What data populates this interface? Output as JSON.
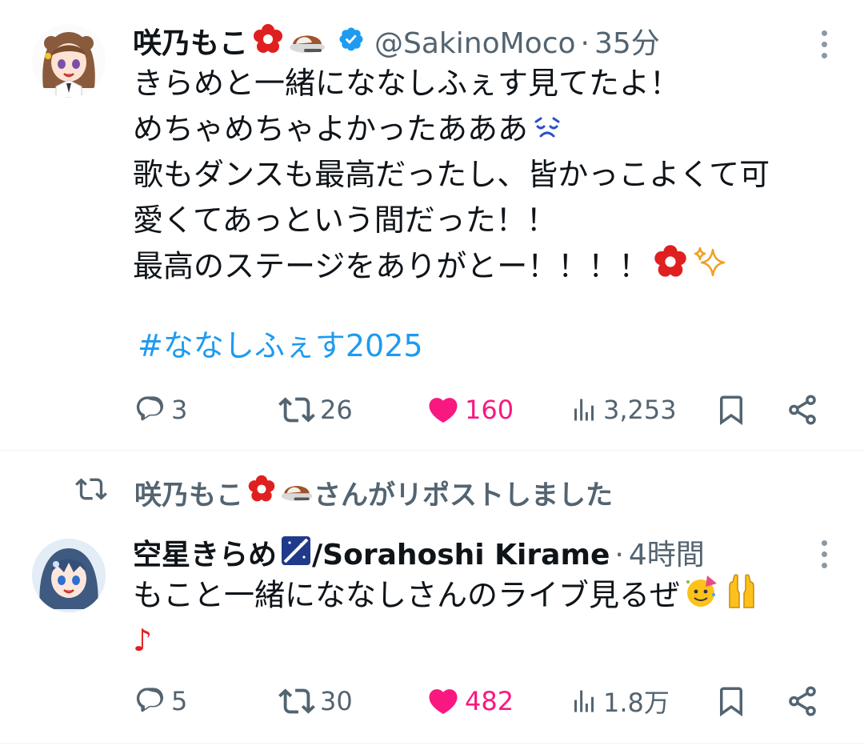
{
  "tweets": [
    {
      "author_name": "咲乃もこ",
      "handle": "@SakinoMoco",
      "separator": "·",
      "time": "35分",
      "lines": [
        "きらめと一緒にななしふぇす見てたよ！",
        "めちゃめちゃよかったあああ",
        "歌もダンスも最高だったし、皆かっこよくて可",
        "愛くてあっという間だった！！",
        "最高のステージをありがとー！！！！"
      ],
      "hashtag": "#ななしふぇす2025",
      "replies": "3",
      "reposts": "26",
      "likes": "160",
      "views": "3,253"
    },
    {
      "repost_label": "咲乃もこ",
      "repost_suffix": "さんがリポストしました",
      "author_name_prefix": "空星きらめ",
      "author_name_suffix": "/Sorahoshi Kirame",
      "separator": "·",
      "time": "4時間",
      "lines": [
        "もこと一緒にななしさんのライブ見るぜ",
        "♪"
      ],
      "replies": "5",
      "reposts": "30",
      "likes": "482",
      "views": "1.8万"
    }
  ],
  "icons": {
    "reply": "reply-icon",
    "repost": "repost-icon",
    "like": "heart-icon",
    "views": "views-chart-icon",
    "bookmark": "bookmark-icon",
    "share": "share-icon",
    "more": "more-dots-icon",
    "verified": "verified-badge-icon"
  },
  "colors": {
    "like": "#f91880",
    "link": "#1d9bf0",
    "secondary": "#536471",
    "verified": "#1d9bf0"
  }
}
